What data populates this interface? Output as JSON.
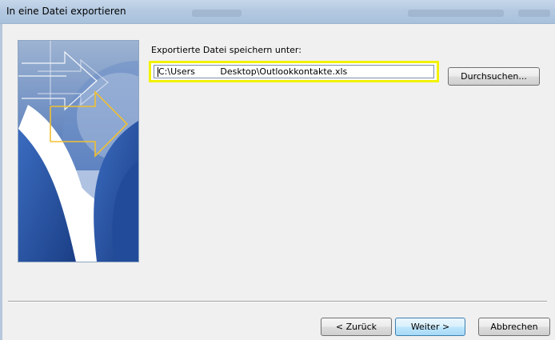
{
  "window": {
    "title": "In eine Datei exportieren"
  },
  "form": {
    "label": "Exportierte Datei speichern unter:",
    "path_value": "C:\\Users         Desktop\\Outlookkontakte.xls",
    "browse_label": "Durchsuchen..."
  },
  "buttons": {
    "back": "< Zurück",
    "next": "Weiter >",
    "cancel": "Abbrechen"
  },
  "colors": {
    "highlight": "#f2f200",
    "art_blue": "#2f63b1",
    "arrow_gold": "#f0c030",
    "titlebar": "#b4c9e1"
  },
  "icons": {
    "wizard_art": "export-arrows-graphic"
  }
}
